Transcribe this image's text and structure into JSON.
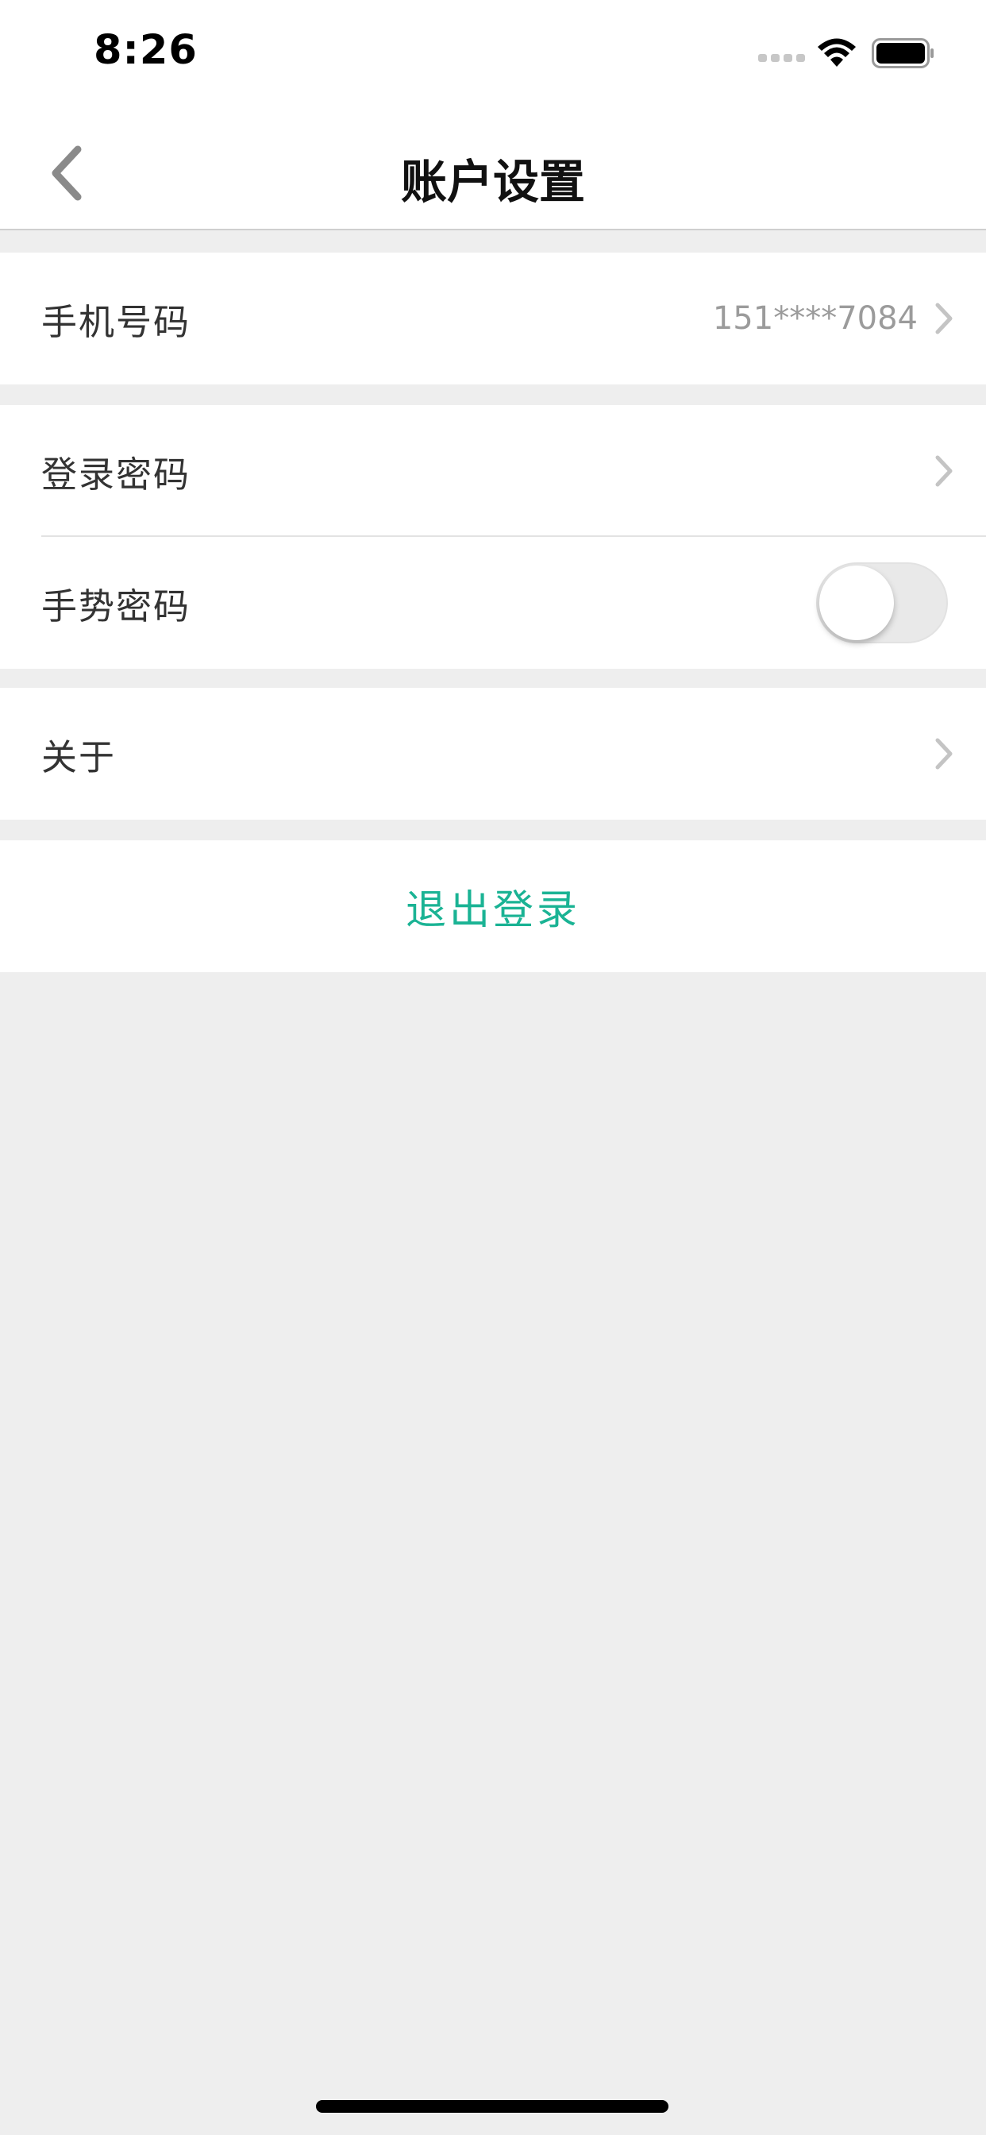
{
  "status_bar": {
    "time": "8:26"
  },
  "nav": {
    "title": "账户设置",
    "back_icon": "chevron-left-icon"
  },
  "phone_row": {
    "label": "手机号码",
    "value": "151****7084"
  },
  "login_password_row": {
    "label": "登录密码"
  },
  "gesture_password_row": {
    "label": "手势密码",
    "toggle_on": false
  },
  "about_row": {
    "label": "关于"
  },
  "logout": {
    "label": "退出登录"
  },
  "colors": {
    "accent": "#1ab394",
    "background": "#eeeeee",
    "value_text": "#9b9b9b"
  }
}
